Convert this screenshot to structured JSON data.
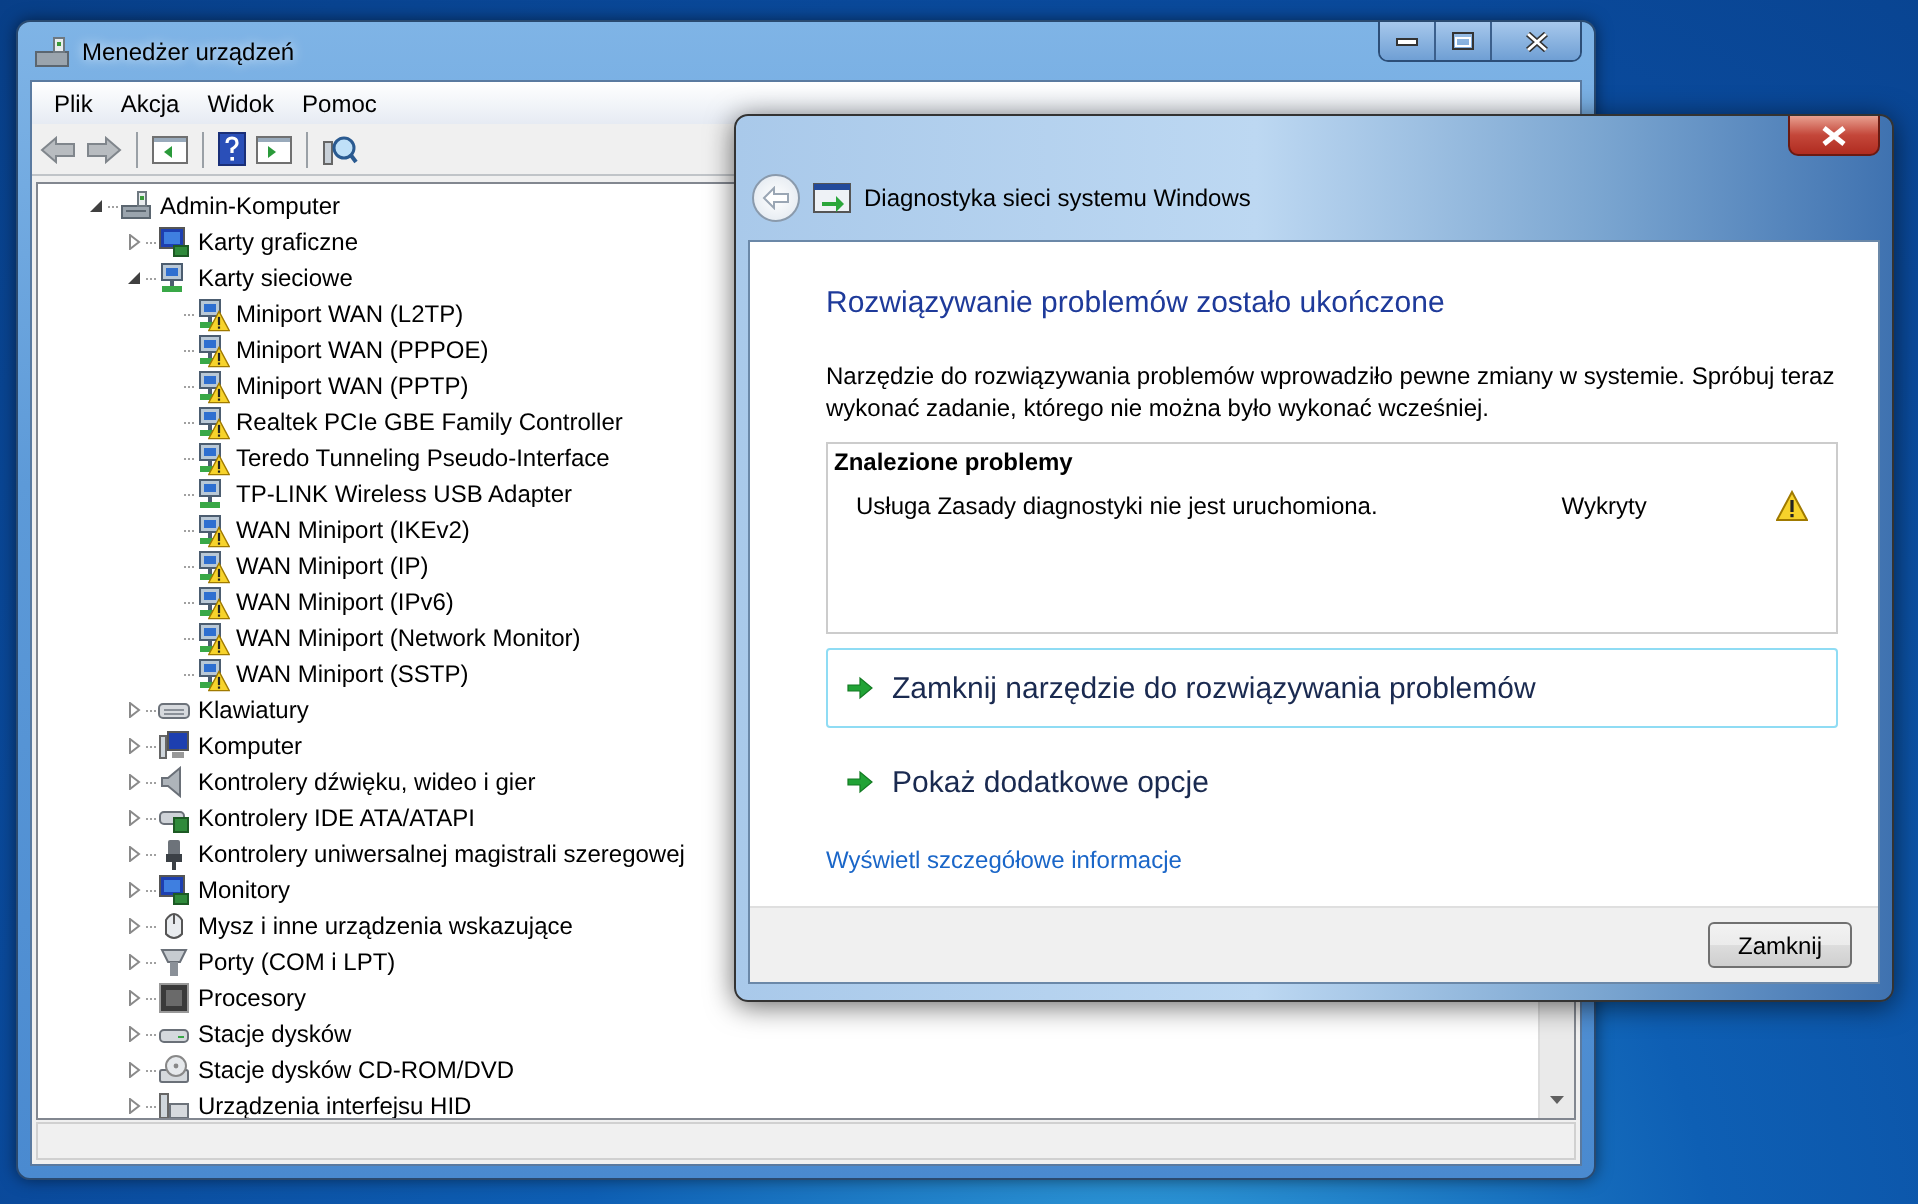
{
  "device_manager": {
    "title": "Menedżer urządzeń",
    "menu": [
      "Plik",
      "Akcja",
      "Widok",
      "Pomoc"
    ],
    "toolbar": [
      {
        "kind": "back"
      },
      {
        "kind": "forward"
      },
      {
        "kind": "sep"
      },
      {
        "kind": "tree-view"
      },
      {
        "kind": "sep"
      },
      {
        "kind": "help"
      },
      {
        "kind": "panel"
      },
      {
        "kind": "sep"
      },
      {
        "kind": "scan"
      }
    ],
    "tree": [
      {
        "label": "Admin-Komputer",
        "kind": "computer",
        "expanded": true,
        "children": [
          {
            "label": "Karty graficzne",
            "kind": "display",
            "expanded": false
          },
          {
            "label": "Karty sieciowe",
            "kind": "network",
            "expanded": true,
            "children": [
              {
                "label": "Miniport WAN (L2TP)",
                "kind": "network",
                "warning": true
              },
              {
                "label": "Miniport WAN (PPPOE)",
                "kind": "network",
                "warning": true
              },
              {
                "label": "Miniport WAN (PPTP)",
                "kind": "network",
                "warning": true
              },
              {
                "label": "Realtek PCIe GBE Family Controller",
                "kind": "network",
                "warning": true
              },
              {
                "label": "Teredo Tunneling Pseudo-Interface",
                "kind": "network",
                "warning": true
              },
              {
                "label": "TP-LINK Wireless USB Adapter",
                "kind": "network",
                "warning": false
              },
              {
                "label": "WAN Miniport (IKEv2)",
                "kind": "network",
                "warning": true
              },
              {
                "label": "WAN Miniport (IP)",
                "kind": "network",
                "warning": true
              },
              {
                "label": "WAN Miniport (IPv6)",
                "kind": "network",
                "warning": true
              },
              {
                "label": "WAN Miniport (Network Monitor)",
                "kind": "network",
                "warning": true
              },
              {
                "label": "WAN Miniport (SSTP)",
                "kind": "network",
                "warning": true
              }
            ]
          },
          {
            "label": "Klawiatury",
            "kind": "keyboard",
            "expanded": false
          },
          {
            "label": "Komputer",
            "kind": "pc",
            "expanded": false
          },
          {
            "label": "Kontrolery dźwięku, wideo i gier",
            "kind": "speaker",
            "expanded": false
          },
          {
            "label": "Kontrolery IDE ATA/ATAPI",
            "kind": "card",
            "expanded": false
          },
          {
            "label": "Kontrolery uniwersalnej magistrali szeregowej",
            "kind": "usb",
            "expanded": false
          },
          {
            "label": "Monitory",
            "kind": "display",
            "expanded": false
          },
          {
            "label": "Mysz i inne urządzenia wskazujące",
            "kind": "mouse",
            "expanded": false
          },
          {
            "label": "Porty (COM i LPT)",
            "kind": "port",
            "expanded": false
          },
          {
            "label": "Procesory",
            "kind": "chip",
            "expanded": false
          },
          {
            "label": "Stacje dysków",
            "kind": "drive",
            "expanded": false
          },
          {
            "label": "Stacje dysków CD-ROM/DVD",
            "kind": "cdrom",
            "expanded": false
          },
          {
            "label": "Urządzenia interfejsu HID",
            "kind": "hid",
            "expanded": false
          }
        ]
      }
    ]
  },
  "dialog": {
    "title": "Diagnostyka sieci systemu Windows",
    "heading": "Rozwiązywanie problemów zostało ukończone",
    "description": "Narzędzie do rozwiązywania problemów wprowadziło pewne zmiany w systemie. Spróbuj teraz wykonać zadanie, którego nie można było wykonać wcześniej.",
    "problems": {
      "title": "Znalezione problemy",
      "rows": [
        {
          "text": "Usługa Zasady diagnostyki nie jest uruchomiona.",
          "status": "Wykryty",
          "warning": true
        }
      ]
    },
    "commands": [
      {
        "label": "Zamknij narzędzie do rozwiązywania problemów",
        "selected": true
      },
      {
        "label": "Pokaż dodatkowe opcje",
        "selected": false
      }
    ],
    "link": "Wyświetl szczegółowe informacje",
    "button": "Zamknij"
  }
}
